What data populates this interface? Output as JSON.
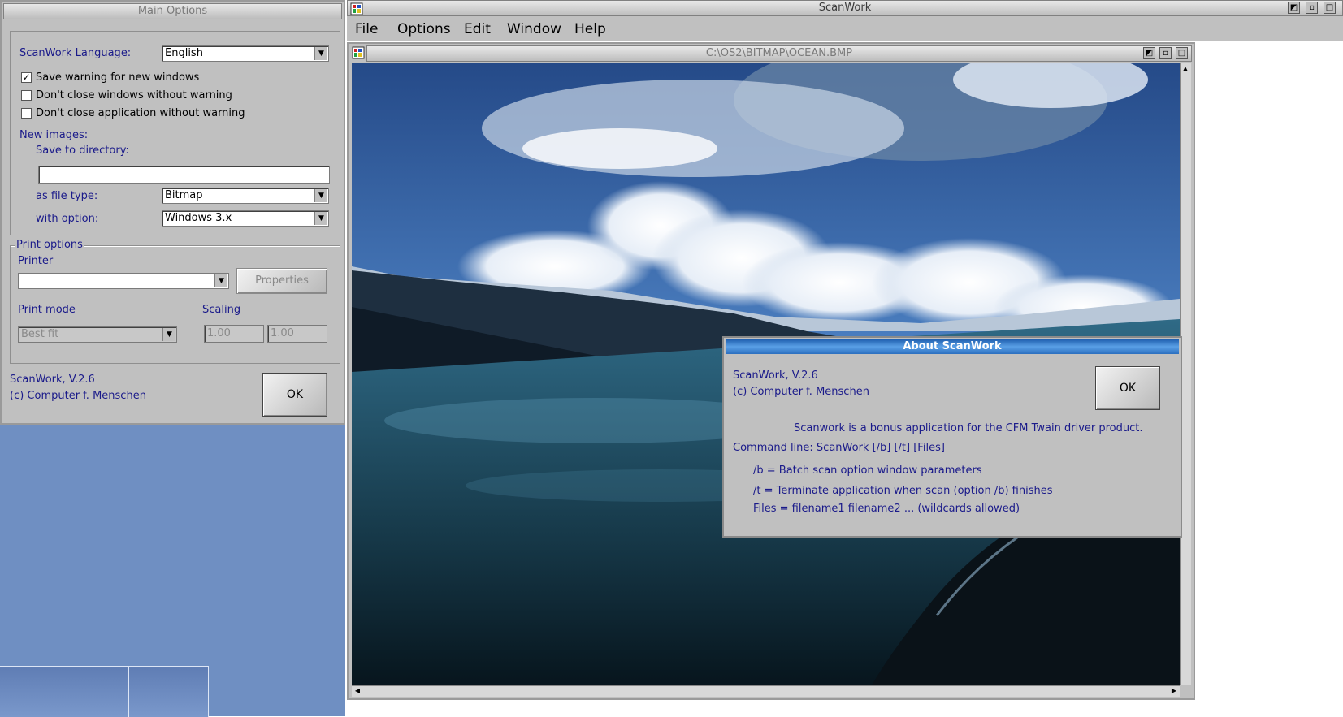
{
  "main_options": {
    "title": "Main Options",
    "language_label": "ScanWork Language:",
    "language_value": "English",
    "checkbox_save_warning": "Save warning for new windows",
    "checkbox_save_warning_checked": true,
    "checkbox_close_windows": "Don't close windows without warning",
    "checkbox_close_app": "Don't close application without warning",
    "new_images_label": "New images:",
    "save_dir_label": "Save to directory:",
    "save_dir_value": "",
    "file_type_label": "as file type:",
    "file_type_value": "Bitmap",
    "with_option_label": "with option:",
    "with_option_value": "Windows 3.x",
    "print_options_label": "Print options",
    "printer_label": "Printer",
    "printer_value": "",
    "properties_button": "Properties",
    "print_mode_label": "Print mode",
    "print_mode_value": "Best fit",
    "scaling_label": "Scaling",
    "scaling_x": "1.00",
    "scaling_y": "1.00",
    "version": "ScanWork, V.2.6",
    "copyright": "(c) Computer f. Menschen",
    "ok_button": "OK"
  },
  "scanwork": {
    "title": "ScanWork",
    "menu": {
      "file": "File",
      "options": "Options",
      "edit": "Edit",
      "window": "Window",
      "help": "Help"
    },
    "child_title": "C:\\OS2\\BITMAP\\OCEAN.BMP"
  },
  "about": {
    "title": "About ScanWork",
    "version": "ScanWork, V.2.6",
    "copyright": "(c) Computer f. Menschen",
    "ok_button": "OK",
    "bonus": "Scanwork is a bonus application for the CFM Twain driver product.",
    "command_line": "Command line: ScanWork [/b] [/t] [Files]",
    "opt_b": "/b = Batch scan option window parameters",
    "opt_t": "/t = Terminate application when scan (option /b) finishes",
    "opt_files": "Files = filename1 filename2 ... (wildcards allowed)"
  },
  "colors": {
    "desktop": "#6f8fc2",
    "dialog": "#c0c0c0",
    "label_text": "#1a1a8a",
    "about_title": "#2b6fc0"
  },
  "icons": [
    "window-system-icon",
    "maximize-icon",
    "restore-icon",
    "minimize-icon",
    "dropdown-arrow-icon",
    "check-icon",
    "scroll-up-icon",
    "scroll-left-icon",
    "scroll-right-icon"
  ]
}
